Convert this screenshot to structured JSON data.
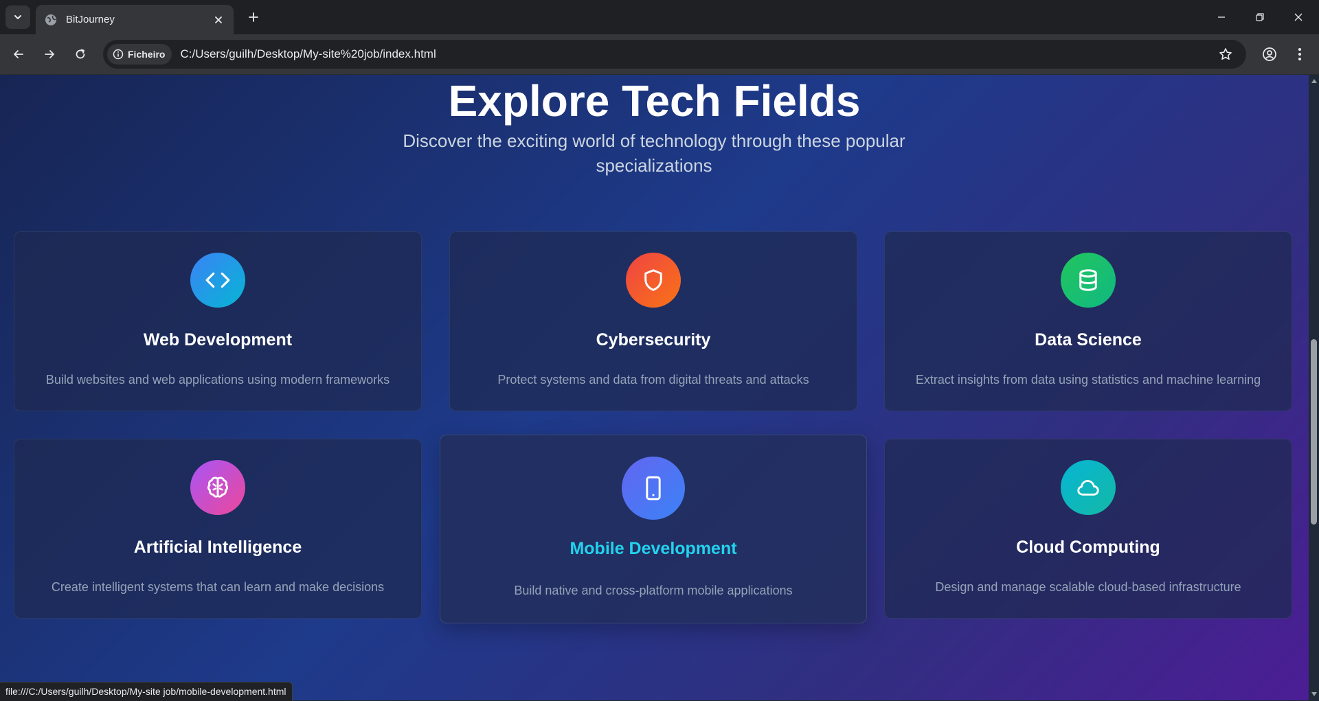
{
  "browser": {
    "tab_title": "BitJourney",
    "site_chip": "Ficheiro",
    "url": "C:/Users/guilh/Desktop/My-site%20job/index.html",
    "status_url": "file:///C:/Users/guilh/Desktop/My-site job/mobile-development.html"
  },
  "page": {
    "heading": "Explore Tech Fields",
    "subheading": "Discover the exciting world of technology through these popular specializations",
    "cards": [
      {
        "title": "Web Development",
        "description": "Build websites and web applications using modern frameworks",
        "icon": "code-icon",
        "gradient": [
          "#3b82f6",
          "#06b6d4"
        ]
      },
      {
        "title": "Cybersecurity",
        "description": "Protect systems and data from digital threats and attacks",
        "icon": "shield-icon",
        "gradient": [
          "#ef4444",
          "#f97316"
        ]
      },
      {
        "title": "Data Science",
        "description": "Extract insights from data using statistics and machine learning",
        "icon": "database-icon",
        "gradient": [
          "#22c55e",
          "#10b981"
        ]
      },
      {
        "title": "Artificial Intelligence",
        "description": "Create intelligent systems that can learn and make decisions",
        "icon": "brain-icon",
        "gradient": [
          "#a855f7",
          "#ec4899"
        ]
      },
      {
        "title": "Mobile Development",
        "description": "Build native and cross-platform mobile applications",
        "icon": "smartphone-icon",
        "gradient": [
          "#6366f1",
          "#3b82f6"
        ]
      },
      {
        "title": "Cloud Computing",
        "description": "Design and manage scalable cloud-based infrastructure",
        "icon": "cloud-icon",
        "gradient": [
          "#06b6d4",
          "#14b8a6"
        ]
      }
    ]
  },
  "colors": {
    "hover_title": "#22d3ee",
    "heading": "#ffffff",
    "description": "#94a3b8"
  }
}
